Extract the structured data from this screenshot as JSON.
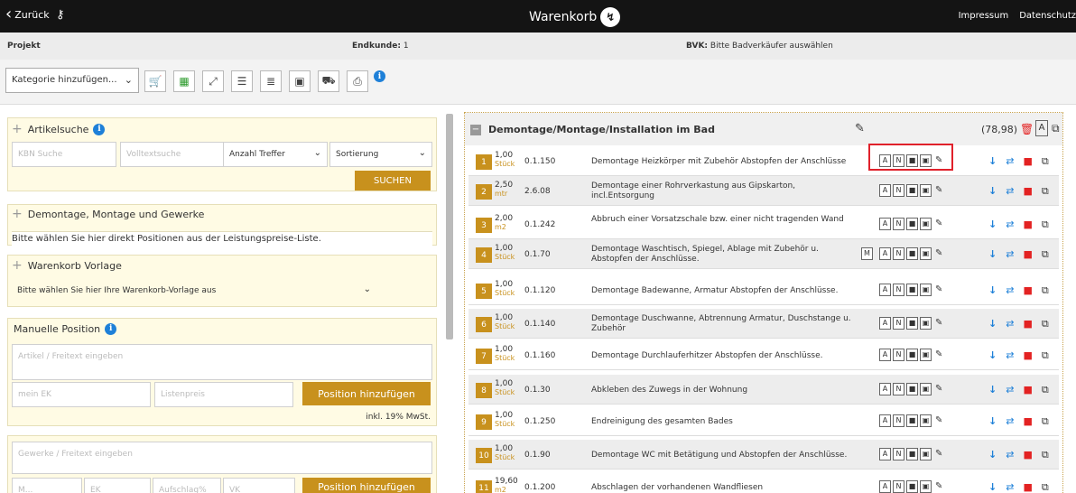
{
  "topbar": {
    "back_label": "Zurück",
    "title": "Warenkorb",
    "links": [
      "Impressum",
      "Datenschutz"
    ]
  },
  "infobar": {
    "projekt_label": "Projekt",
    "endkunde_label": "Endkunde:",
    "endkunde_value": "1",
    "bvk_label": "BVK:",
    "bvk_value": "Bitte Badverkäufer auswählen"
  },
  "toolbar": {
    "category_select": "Kategorie hinzufügen..."
  },
  "left": {
    "artikelsuche_title": "Artikelsuche",
    "kbn_placeholder": "KBN Suche",
    "volltext_placeholder": "Volltextsuche",
    "anzahl_select": "Anzahl Treffer",
    "sort_select": "Sortierung",
    "search_button": "SUCHEN",
    "demontage_title": "Demontage, Montage und Gewerke",
    "demontage_text": "Bitte wählen Sie hier direkt Positionen aus der Leistungspreise-Liste.",
    "vorlage_title": "Warenkorb Vorlage",
    "vorlage_select": "Bitte wählen Sie hier Ihre Warenkorb-Vorlage aus",
    "manuelle_title": "Manuelle Position",
    "artikel_placeholder": "Artikel / Freitext eingeben",
    "ek_placeholder": "mein EK",
    "listenpreis_placeholder": "Listenpreis",
    "add_button": "Position hinzufügen",
    "mwst_text": "inkl. 19% MwSt.",
    "gewerke_placeholder": "Gewerke / Freitext eingeben",
    "menge_placeholder": "M...",
    "ek2_placeholder": "EK",
    "aufschlag_placeholder": "Aufschlag%",
    "vk_placeholder": "VK",
    "add_button2": "Position hinzufügen"
  },
  "group": {
    "title": "Demontage/Montage/Installation im Bad",
    "sum": "(78,98)",
    "a_label": "A"
  },
  "rows": [
    {
      "num": "1",
      "qty": "1,00",
      "unit": "Stück",
      "code": "0.1.150",
      "desc": "Demontage Heizkörper mit Zubehör Abstopfen der Anschlüsse",
      "m": false
    },
    {
      "num": "2",
      "qty": "2,50",
      "unit": "mtr",
      "code": "2.6.08",
      "desc": "Demontage einer Rohrverkastung aus Gipskarton, incl.Entsorgung",
      "m": false
    },
    {
      "num": "3",
      "qty": "2,00",
      "unit": "m2",
      "code": "0.1.242",
      "desc": "Abbruch einer Vorsatzschale bzw. einer nicht tragenden Wand",
      "m": false
    },
    {
      "num": "4",
      "qty": "1,00",
      "unit": "Stück",
      "code": "0.1.70",
      "desc": "Demontage Waschtisch, Spiegel, Ablage mit Zubehör u. Abstopfen der Anschlüsse.",
      "m": true
    },
    {
      "num": "5",
      "qty": "1,00",
      "unit": "Stück",
      "code": "0.1.120",
      "desc": "Demontage Badewanne, Armatur Abstopfen der Anschlüsse.",
      "m": false
    },
    {
      "num": "6",
      "qty": "1,00",
      "unit": "Stück",
      "code": "0.1.140",
      "desc": "Demontage Duschwanne, Abtrennung Armatur, Duschstange u. Zubehör",
      "m": false
    },
    {
      "num": "7",
      "qty": "1,00",
      "unit": "Stück",
      "code": "0.1.160",
      "desc": "Demontage Durchlauferhitzer Abstopfen der Anschlüsse.",
      "m": false
    },
    {
      "num": "8",
      "qty": "1,00",
      "unit": "Stück",
      "code": "0.1.30",
      "desc": "Abkleben des Zuwegs in der Wohnung",
      "m": false
    },
    {
      "num": "9",
      "qty": "1,00",
      "unit": "Stück",
      "code": "0.1.250",
      "desc": "Endreinigung des gesamten Bades",
      "m": false
    },
    {
      "num": "10",
      "qty": "1,00",
      "unit": "Stück",
      "code": "0.1.90",
      "desc": "Demontage WC mit Betätigung und Abstopfen der Anschlüsse.",
      "m": false
    },
    {
      "num": "11",
      "qty": "19,60",
      "unit": "m2",
      "code": "0.1.200",
      "desc": "Abschlagen der vorhandenen Wandfliesen",
      "m": false
    }
  ],
  "row_buttons": {
    "a": "A",
    "n": "N",
    "m": "M"
  },
  "colors": {
    "accent": "#c8911d",
    "highlight": "#e0212b",
    "info": "#1e80d8"
  }
}
